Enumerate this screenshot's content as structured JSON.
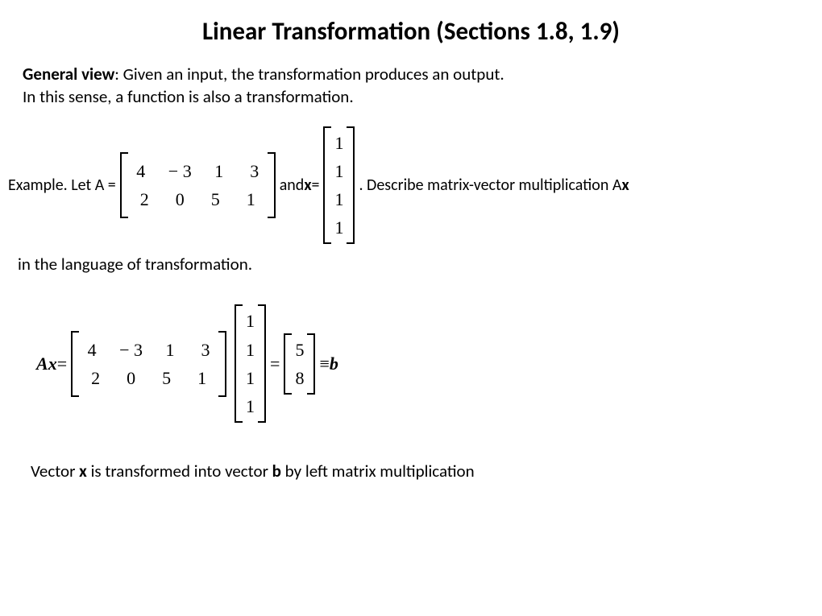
{
  "title": "Linear Transformation (Sections 1.8, 1.9)",
  "para1_label": "General view",
  "para1_line1": ": Given an input, the transformation produces an output.",
  "para1_line2": "In this sense, a function is also a transformation.",
  "example_prefix": "Example. Let A = ",
  "matrixA": {
    "r1c1": "4",
    "r1c2": "− 3",
    "r1c3": "1",
    "r1c4": "3",
    "r2c1": "2",
    "r2c2": "0",
    "r2c3": "5",
    "r2c4": "1"
  },
  "and_x": " and ",
  "x_label": "x",
  "equals": " = ",
  "vectorX": {
    "r1": "1",
    "r2": "1",
    "r3": "1",
    "r4": "1"
  },
  "describe_text": " . Describe matrix-vector multiplication A",
  "lang_text": " in the language of transformation.",
  "eq_lhs_A": "A",
  "eq_lhs_x": "x",
  "eq_lhs_eq": " = ",
  "eq_eq2": " = ",
  "vectorB": {
    "r1": "5",
    "r2": "8"
  },
  "eq_equiv": " ≡ ",
  "eq_b": "b",
  "conclusion_pre": "Vector ",
  "conclusion_x": "x",
  "conclusion_mid": " is transformed into vector ",
  "conclusion_b": "b",
  "conclusion_post": " by left matrix multiplication"
}
